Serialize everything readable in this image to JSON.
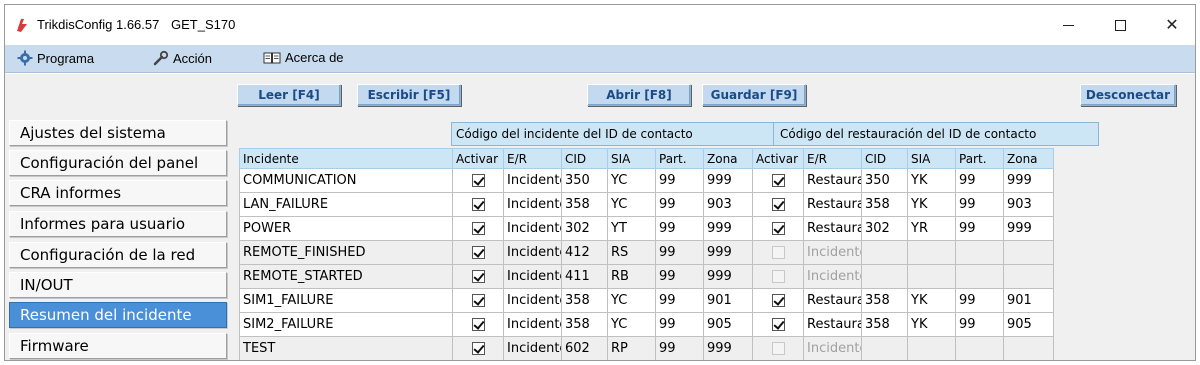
{
  "window": {
    "app_name": "TrikdisConfig 1.66.57",
    "device": "GET_S170"
  },
  "menu": {
    "items": [
      "Programa",
      "Acción",
      "Acerca de"
    ]
  },
  "toolbar": {
    "read_label": "Leer [F4]",
    "write_label": "Escribir [F5]",
    "open_label": "Abrir [F8]",
    "save_label": "Guardar [F9]",
    "disconnect_label": "Desconectar"
  },
  "sidebar": {
    "items": [
      "Ajustes del sistema",
      "Configuración del panel",
      "CRA informes",
      "Informes para usuario",
      "Configuración de la red",
      "IN/OUT",
      "Resumen del incidente",
      "Firmware"
    ],
    "active_index": 6
  },
  "table": {
    "group_incidente": "Código del incidente del ID de contacto",
    "group_restauracion": "Código del restauración del ID de contacto",
    "columns": [
      "Incidente",
      "Activar",
      "E/R",
      "CID",
      "SIA",
      "Part.",
      "Zona",
      "Activar",
      "E/R",
      "CID",
      "SIA",
      "Part.",
      "Zona"
    ],
    "rows": [
      {
        "name": "COMMUNICATION",
        "act1": true,
        "er1": "Incidente",
        "cid1": "350",
        "sia1": "YC",
        "part1": "99",
        "zona1": "999",
        "act2": true,
        "er2": "Restauración",
        "cid2": "350",
        "sia2": "YK",
        "part2": "99",
        "zona2": "999",
        "enabled2": true
      },
      {
        "name": "LAN_FAILURE",
        "act1": true,
        "er1": "Incidente",
        "cid1": "358",
        "sia1": "YC",
        "part1": "99",
        "zona1": "903",
        "act2": true,
        "er2": "Restauración",
        "cid2": "358",
        "sia2": "YK",
        "part2": "99",
        "zona2": "903",
        "enabled2": true
      },
      {
        "name": "POWER",
        "act1": true,
        "er1": "Incidente",
        "cid1": "302",
        "sia1": "YT",
        "part1": "99",
        "zona1": "999",
        "act2": true,
        "er2": "Restauración",
        "cid2": "302",
        "sia2": "YR",
        "part2": "99",
        "zona2": "999",
        "enabled2": true
      },
      {
        "name": "REMOTE_FINISHED",
        "act1": true,
        "er1": "Incidente",
        "cid1": "412",
        "sia1": "RS",
        "part1": "99",
        "zona1": "999",
        "act2": false,
        "er2": "Incidente",
        "cid2": "",
        "sia2": "",
        "part2": "",
        "zona2": "",
        "enabled2": false
      },
      {
        "name": "REMOTE_STARTED",
        "act1": true,
        "er1": "Incidente",
        "cid1": "411",
        "sia1": "RB",
        "part1": "99",
        "zona1": "999",
        "act2": false,
        "er2": "Incidente",
        "cid2": "",
        "sia2": "",
        "part2": "",
        "zona2": "",
        "enabled2": false
      },
      {
        "name": "SIM1_FAILURE",
        "act1": true,
        "er1": "Incidente",
        "cid1": "358",
        "sia1": "YC",
        "part1": "99",
        "zona1": "901",
        "act2": true,
        "er2": "Restauración",
        "cid2": "358",
        "sia2": "YK",
        "part2": "99",
        "zona2": "901",
        "enabled2": true
      },
      {
        "name": "SIM2_FAILURE",
        "act1": true,
        "er1": "Incidente",
        "cid1": "358",
        "sia1": "YC",
        "part1": "99",
        "zona1": "905",
        "act2": true,
        "er2": "Restauración",
        "cid2": "358",
        "sia2": "YK",
        "part2": "99",
        "zona2": "905",
        "enabled2": true
      },
      {
        "name": "TEST",
        "act1": true,
        "er1": "Incidente",
        "cid1": "602",
        "sia1": "RP",
        "part1": "99",
        "zona1": "999",
        "act2": false,
        "er2": "Incidente",
        "cid2": "",
        "sia2": "",
        "part2": "",
        "zona2": "",
        "enabled2": false
      }
    ]
  },
  "colors": {
    "menubar": "#c9dcef",
    "active_item": "#4a90d9",
    "header": "#cde6f5",
    "button_text": "#1b4b86"
  }
}
